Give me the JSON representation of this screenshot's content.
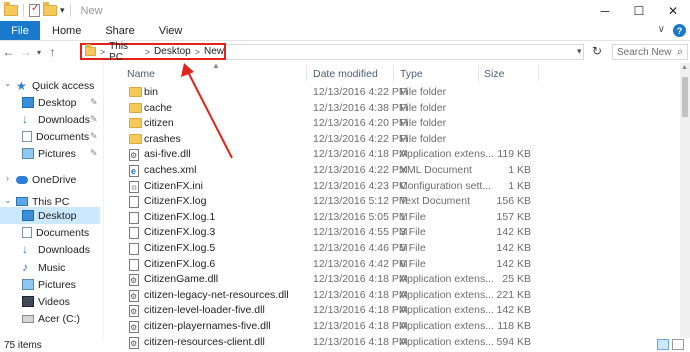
{
  "window": {
    "title": "New",
    "minimize_glyph": "─",
    "maximize_glyph": "☐",
    "close_glyph": "✕",
    "qa_dropdown_glyph": "▾"
  },
  "ribbon": {
    "tabs": [
      "File",
      "Home",
      "Share",
      "View"
    ],
    "expand_glyph": "∨",
    "help_glyph": "?"
  },
  "nav": {
    "back_glyph": "←",
    "forward_glyph": "→",
    "recent_glyph": "▾",
    "up_glyph": "↑",
    "crumb_sep": ">",
    "breadcrumb": [
      "This PC",
      "Desktop",
      "New"
    ],
    "address_dropdown_glyph": "▾",
    "refresh_glyph": "↻",
    "search_placeholder": "Search New",
    "search_glyph": "⌕"
  },
  "sidebar": {
    "chevron_expand": "›",
    "chevron_collapse": "⌄",
    "pin_glyph": "✎",
    "quick_access_label": "Quick access",
    "quick_access": [
      {
        "label": "Desktop",
        "icon": "desktop-icon",
        "pinned": true
      },
      {
        "label": "Downloads",
        "icon": "downloads-icon",
        "pinned": true
      },
      {
        "label": "Documents",
        "icon": "documents-icon",
        "pinned": true
      },
      {
        "label": "Pictures",
        "icon": "pictures-icon",
        "pinned": true
      }
    ],
    "onedrive_label": "OneDrive",
    "this_pc_label": "This PC",
    "this_pc": [
      {
        "label": "Desktop",
        "icon": "desktop-icon",
        "selected": true
      },
      {
        "label": "Documents",
        "icon": "documents-icon"
      },
      {
        "label": "Downloads",
        "icon": "downloads-icon"
      },
      {
        "label": "Music",
        "icon": "music-icon"
      },
      {
        "label": "Pictures",
        "icon": "pictures-icon"
      },
      {
        "label": "Videos",
        "icon": "videos-icon"
      },
      {
        "label": "Acer (C:)",
        "icon": "drive-icon"
      }
    ]
  },
  "columns": {
    "name": "Name",
    "date": "Date modified",
    "type": "Type",
    "size": "Size",
    "sort_glyph": "▲"
  },
  "files": [
    {
      "name": "bin",
      "date": "12/13/2016 4:22 PM",
      "type": "File folder",
      "size": "",
      "kind": "folder"
    },
    {
      "name": "cache",
      "date": "12/13/2016 4:38 PM",
      "type": "File folder",
      "size": "",
      "kind": "folder"
    },
    {
      "name": "citizen",
      "date": "12/13/2016 4:20 PM",
      "type": "File folder",
      "size": "",
      "kind": "folder"
    },
    {
      "name": "crashes",
      "date": "12/13/2016 4:22 PM",
      "type": "File folder",
      "size": "",
      "kind": "folder"
    },
    {
      "name": "asi-five.dll",
      "date": "12/13/2016 4:18 PM",
      "type": "Application extens...",
      "size": "119 KB",
      "kind": "dll"
    },
    {
      "name": "caches.xml",
      "date": "12/13/2016 4:22 PM",
      "type": "XML Document",
      "size": "1 KB",
      "kind": "xml"
    },
    {
      "name": "CitizenFX.ini",
      "date": "12/13/2016 4:23 PM",
      "type": "Configuration sett...",
      "size": "1 KB",
      "kind": "ini"
    },
    {
      "name": "CitizenFX.log",
      "date": "12/13/2016 5:12 PM",
      "type": "Text Document",
      "size": "156 KB",
      "kind": "doc"
    },
    {
      "name": "CitizenFX.log.1",
      "date": "12/13/2016 5:05 PM",
      "type": "1 File",
      "size": "157 KB",
      "kind": "doc"
    },
    {
      "name": "CitizenFX.log.3",
      "date": "12/13/2016 4:55 PM",
      "type": "3 File",
      "size": "142 KB",
      "kind": "doc"
    },
    {
      "name": "CitizenFX.log.5",
      "date": "12/13/2016 4:46 PM",
      "type": "5 File",
      "size": "142 KB",
      "kind": "doc"
    },
    {
      "name": "CitizenFX.log.6",
      "date": "12/13/2016 4:42 PM",
      "type": "6 File",
      "size": "142 KB",
      "kind": "doc"
    },
    {
      "name": "CitizenGame.dll",
      "date": "12/13/2016 4:18 PM",
      "type": "Application extens...",
      "size": "25 KB",
      "kind": "dll"
    },
    {
      "name": "citizen-legacy-net-resources.dll",
      "date": "12/13/2016 4:18 PM",
      "type": "Application extens...",
      "size": "221 KB",
      "kind": "dll"
    },
    {
      "name": "citizen-level-loader-five.dll",
      "date": "12/13/2016 4:18 PM",
      "type": "Application extens...",
      "size": "142 KB",
      "kind": "dll"
    },
    {
      "name": "citizen-playernames-five.dll",
      "date": "12/13/2016 4:18 PM",
      "type": "Application extens...",
      "size": "118 KB",
      "kind": "dll"
    },
    {
      "name": "citizen-resources-client.dll",
      "date": "12/13/2016 4:18 PM",
      "type": "Application extens...",
      "size": "594 KB",
      "kind": "dll"
    }
  ],
  "scrollbar": {
    "up_glyph": "▲"
  },
  "status": {
    "count": "75 items"
  },
  "colors": {
    "accent": "#1979ca",
    "highlight": "#e2231a",
    "selection": "#cce8ff"
  }
}
